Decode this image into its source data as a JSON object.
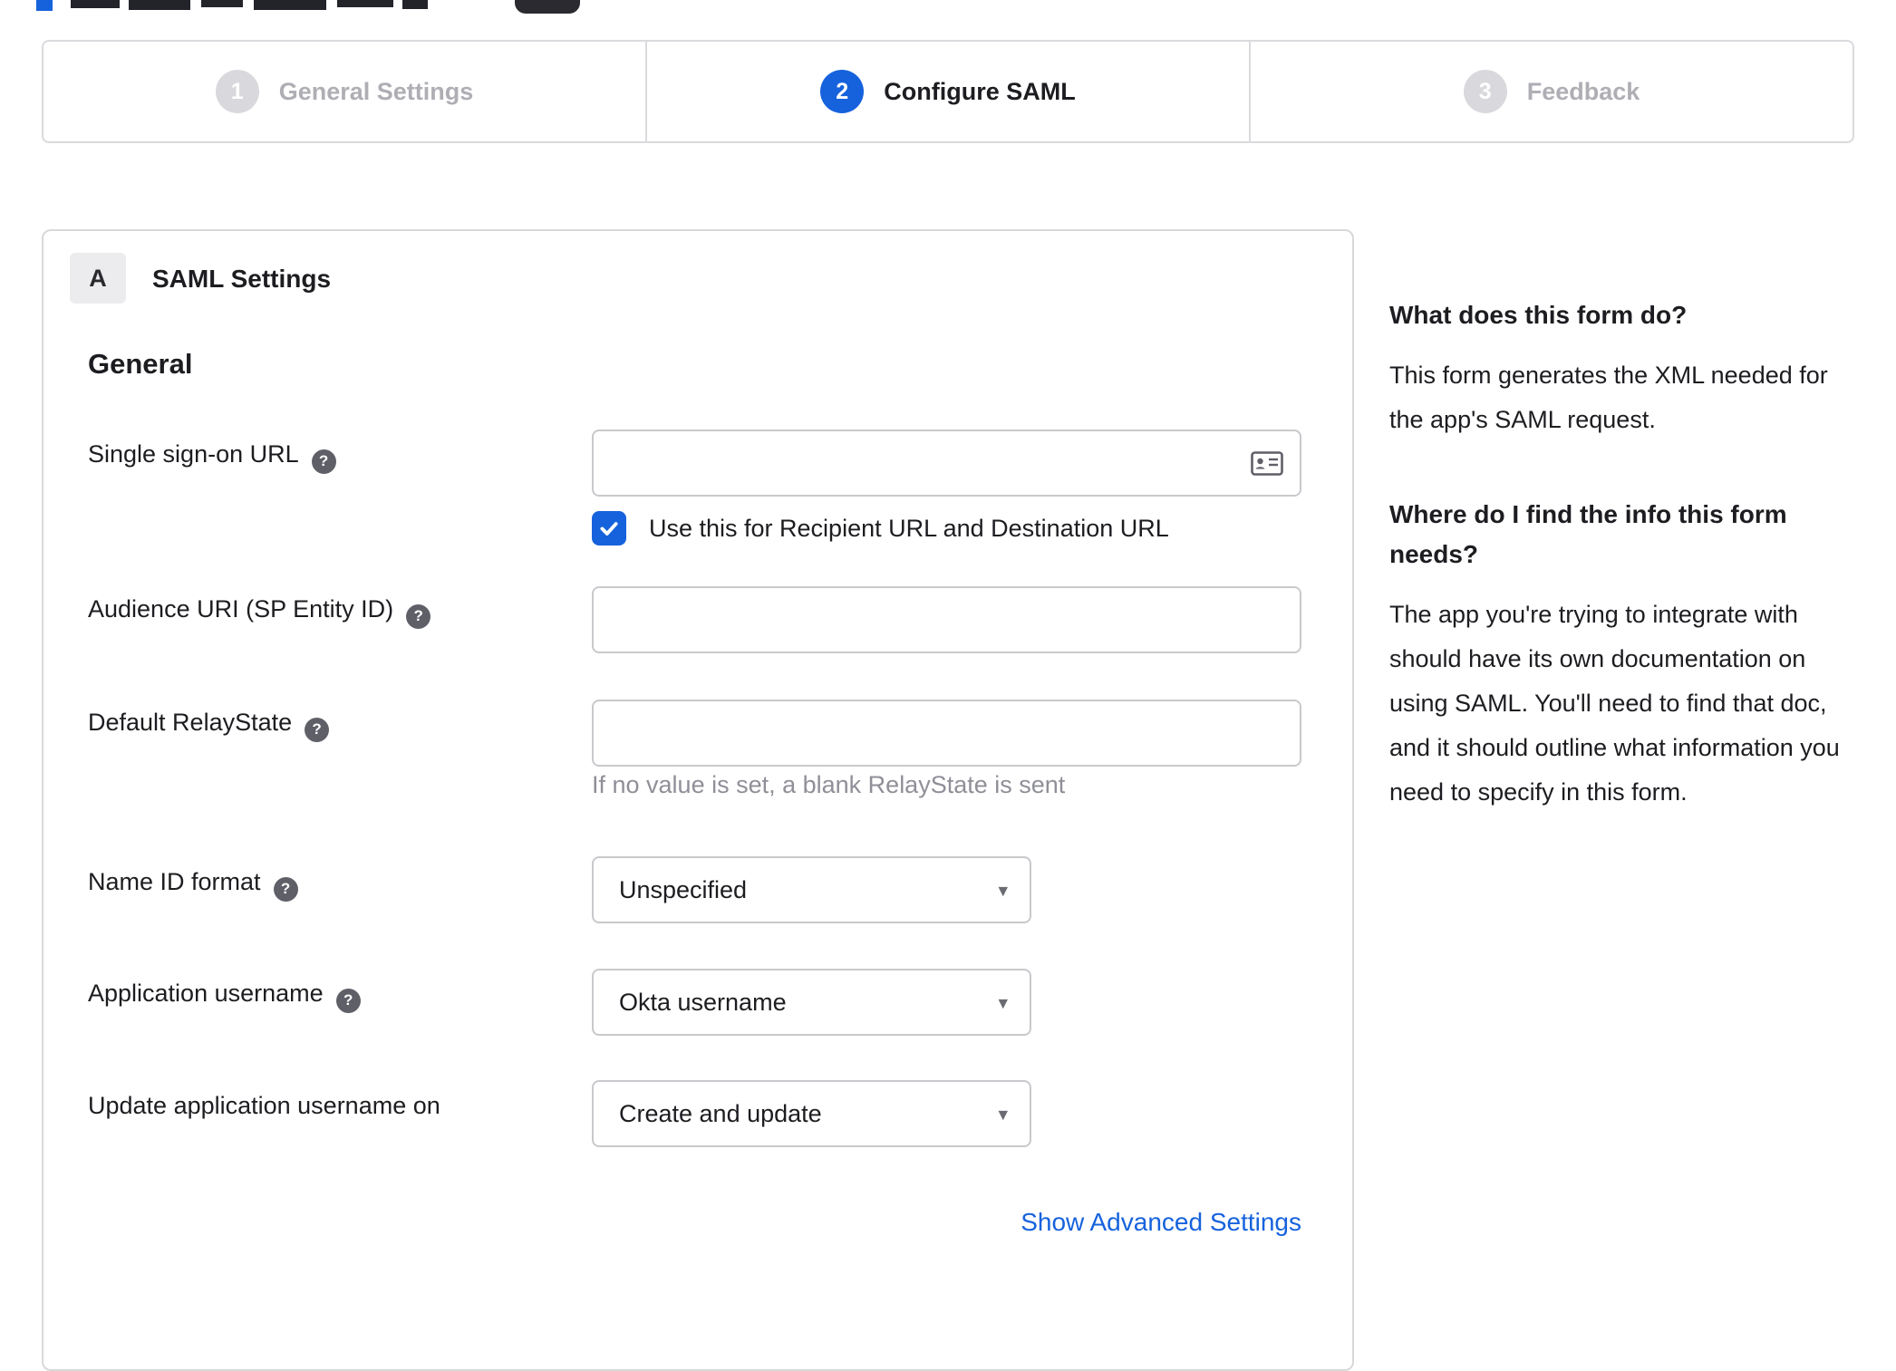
{
  "colors": {
    "accent": "#1662dd",
    "inactive_step": "#d9d9dd",
    "border": "#d8d8dc"
  },
  "icons": {
    "help": "?",
    "caret": "▾"
  },
  "stepper": {
    "steps": [
      {
        "number": "1",
        "label": "General Settings",
        "state": "inactive"
      },
      {
        "number": "2",
        "label": "Configure SAML",
        "state": "active"
      },
      {
        "number": "3",
        "label": "Feedback",
        "state": "inactive"
      }
    ]
  },
  "form": {
    "badge": "A",
    "title": "SAML Settings",
    "group_title": "General",
    "fields": [
      {
        "label": "Single sign-on URL",
        "value": "",
        "checkbox_label": "Use this for Recipient URL and Destination URL",
        "checked": true
      },
      {
        "label": "Audience URI (SP Entity ID)",
        "value": ""
      },
      {
        "label": "Default RelayState",
        "value": "",
        "hint": "If no value is set, a blank RelayState is sent"
      },
      {
        "label": "Name ID format",
        "value": "Unspecified",
        "control": "select"
      },
      {
        "label": "Application username",
        "value": "Okta username",
        "control": "select"
      },
      {
        "label": "Update application username on",
        "value": "Create and update",
        "control": "select"
      }
    ],
    "advanced_link": "Show Advanced Settings"
  },
  "sidebar": {
    "blocks": [
      {
        "heading": "What does this form do?",
        "body": "This form generates the XML needed for the app's SAML request."
      },
      {
        "heading": "Where do I find the info this form needs?",
        "body": "The app you're trying to integrate with should have its own documentation on using SAML. You'll need to find that doc, and it should outline what information you need to specify in this form."
      }
    ]
  }
}
